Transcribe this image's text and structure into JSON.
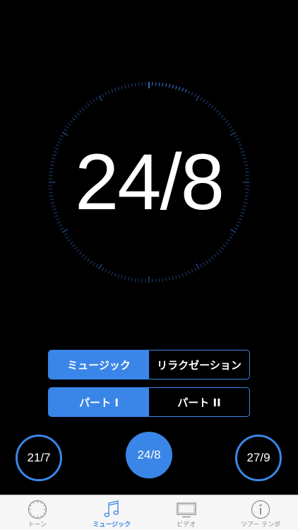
{
  "display": {
    "value": "24/8",
    "progress": 0.06
  },
  "mode_toggle": {
    "options": [
      "ミュージック",
      "リラクゼーション"
    ],
    "selected": "ミュージック"
  },
  "part_toggle": {
    "options": [
      "パート I",
      "パート II"
    ],
    "selected": "パート I"
  },
  "dates": {
    "prev": "21/7",
    "current": "24/8",
    "next": "27/9"
  },
  "tabbar": {
    "tabs": [
      {
        "label": "トーン",
        "icon": "clock-icon"
      },
      {
        "label": "ミュージック",
        "icon": "music-note-icon"
      },
      {
        "label": "ビデオ",
        "icon": "tv-icon"
      },
      {
        "label": "ツアー テンポ",
        "icon": "info-icon"
      }
    ],
    "selected": "ミュージック"
  },
  "colors": {
    "accent": "#3a86e8",
    "background": "#000000",
    "tabbar": "#f6f6f6",
    "inactive": "#8e8e93"
  }
}
